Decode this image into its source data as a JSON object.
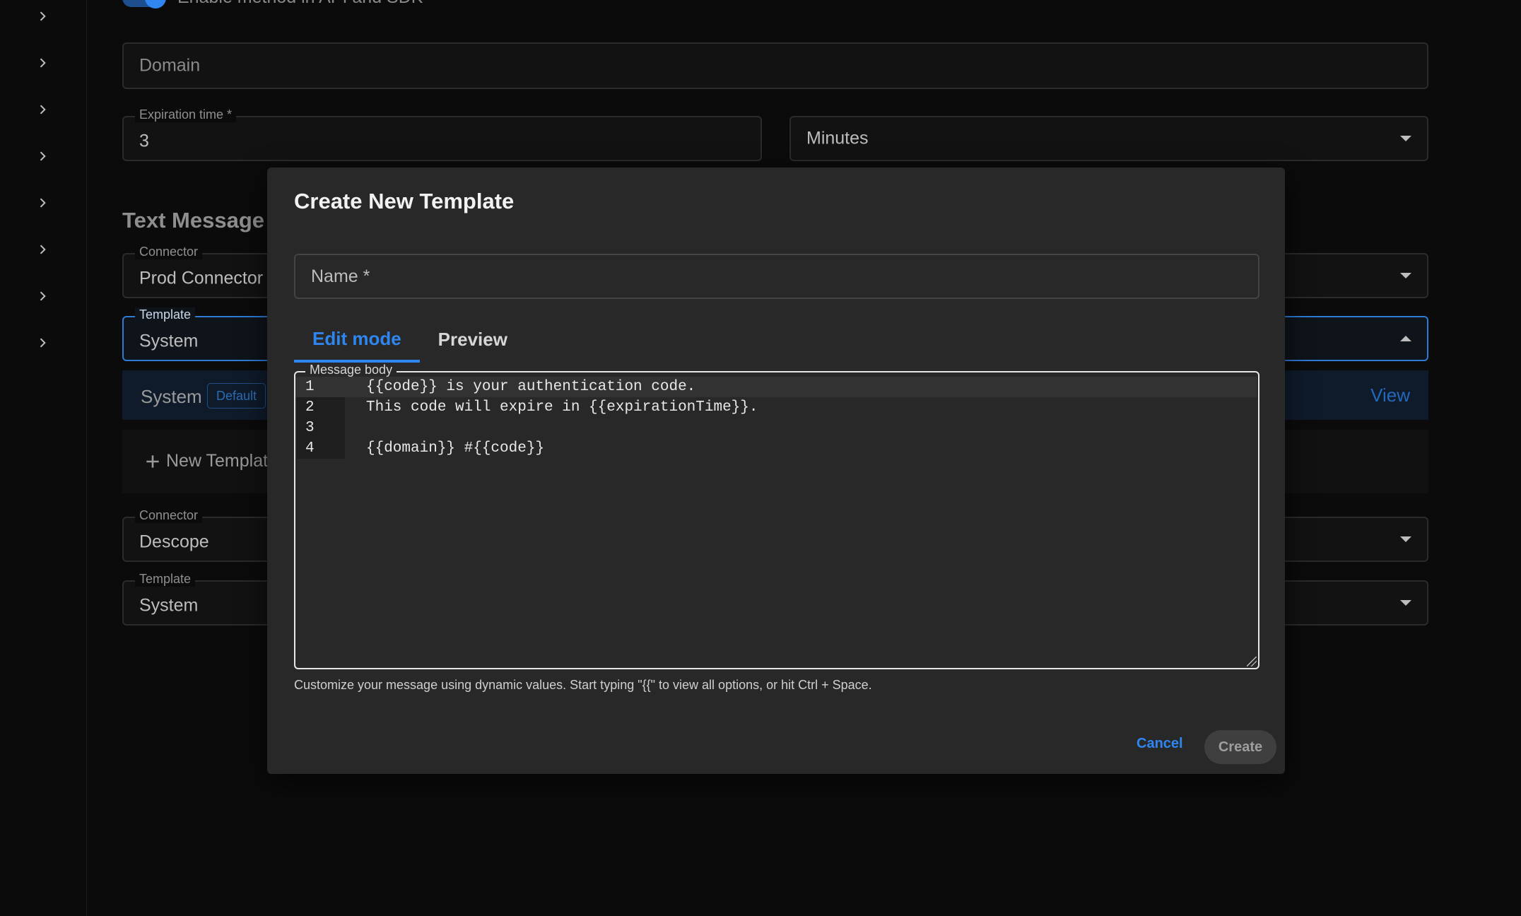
{
  "background": {
    "toggle_label": "Enable method in API and SDK",
    "domain_placeholder": "Domain",
    "expiration": {
      "label": "Expiration time *",
      "value": "3"
    },
    "expiration_unit": {
      "value": "Minutes"
    },
    "section_title": "Text Message",
    "connector": {
      "label": "Connector",
      "value": "Prod Connector"
    },
    "template": {
      "label": "Template",
      "value": "System"
    },
    "system_row": {
      "name": "System",
      "badge": "Default",
      "view": "View"
    },
    "new_template_label": "New Template",
    "connector2": {
      "label": "Connector",
      "value": "Descope"
    },
    "template2": {
      "label": "Template",
      "value": "System"
    }
  },
  "dialog": {
    "title": "Create New Template",
    "name_placeholder": "Name *",
    "tabs": [
      {
        "label": "Edit mode",
        "active": true
      },
      {
        "label": "Preview",
        "active": false
      }
    ],
    "editor": {
      "label": "Message body",
      "lines": [
        {
          "num": "1",
          "text": "{{code}} is your authentication code."
        },
        {
          "num": "2",
          "text": "This code will expire in {{expirationTime}}."
        },
        {
          "num": "3",
          "text": ""
        },
        {
          "num": "4",
          "text": "{{domain}} #{{code}}"
        }
      ]
    },
    "helper_text": "Customize your message using dynamic values. Start typing \"{{\" to view all options, or hit Ctrl + Space.",
    "cancel_label": "Cancel",
    "create_label": "Create"
  },
  "colors": {
    "accent": "#2f86f0",
    "background": "#0b0b0b",
    "dialog": "#282828"
  }
}
